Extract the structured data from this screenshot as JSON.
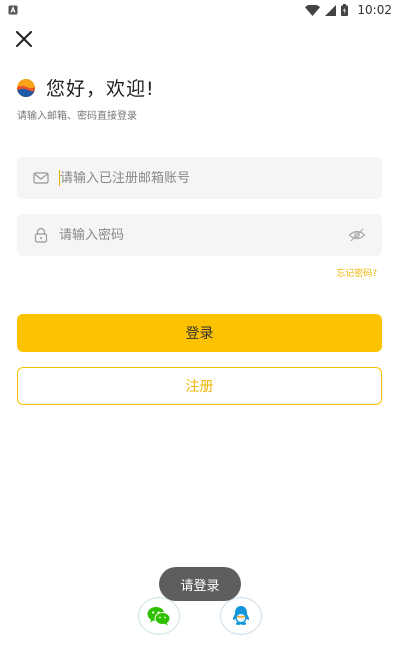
{
  "status_bar": {
    "time": "10:02"
  },
  "greeting": {
    "title": "您好，欢迎!",
    "subtitle": "请输入邮箱、密码直接登录"
  },
  "email_field": {
    "placeholder": "请输入已注册邮箱账号",
    "value": ""
  },
  "password_field": {
    "placeholder": "请输入密码",
    "value": ""
  },
  "forgot_label": "忘记密码?",
  "login_label": "登录",
  "register_label": "注册",
  "toast_text": "请登录",
  "colors": {
    "accent": "#fcc200",
    "accent_text": "#f0b400",
    "toast_bg": "#505050",
    "input_bg": "#f5f5f5",
    "wechat_green": "#2dc100",
    "qq_blue": "#1296db"
  },
  "icons": {
    "close": "close-icon",
    "logo": "app-logo-icon",
    "email": "mail-icon",
    "password": "lock-icon",
    "visibility": "eye-off-icon",
    "wechat": "wechat-icon",
    "qq": "qq-icon"
  }
}
